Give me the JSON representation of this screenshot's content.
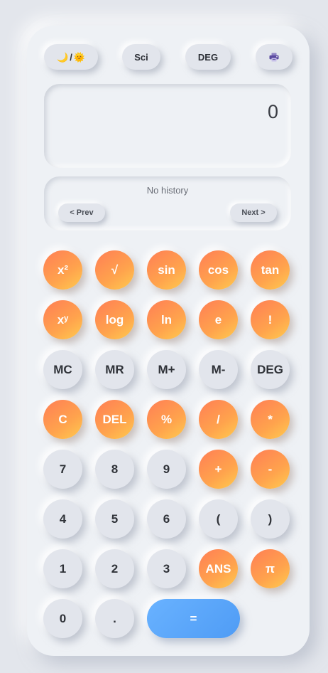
{
  "toolbar": {
    "theme_moon": "🌙",
    "theme_sep": "/",
    "theme_sun": "🌞",
    "mode_label": "Sci",
    "angle_label": "DEG",
    "print_icon": "printer-icon",
    "print_icon_color": "#5b4aa0"
  },
  "display": {
    "value": "0"
  },
  "history": {
    "text": "No history",
    "prev_label": "< Prev",
    "next_label": "Next >"
  },
  "keypad": {
    "rows": [
      [
        {
          "label": "x²",
          "name": "square"
        },
        {
          "label": "√",
          "name": "sqrt"
        },
        {
          "label": "sin",
          "name": "sin"
        },
        {
          "label": "cos",
          "name": "cos"
        },
        {
          "label": "tan",
          "name": "tan"
        }
      ],
      [
        {
          "label": "xʸ",
          "name": "power"
        },
        {
          "label": "log",
          "name": "log"
        },
        {
          "label": "ln",
          "name": "ln"
        },
        {
          "label": "e",
          "name": "euler"
        },
        {
          "label": "!",
          "name": "factorial"
        }
      ],
      [
        {
          "label": "MC",
          "name": "memory-clear"
        },
        {
          "label": "MR",
          "name": "memory-recall"
        },
        {
          "label": "M+",
          "name": "memory-add"
        },
        {
          "label": "M-",
          "name": "memory-subtract"
        },
        {
          "label": "DEG",
          "name": "deg"
        }
      ],
      [
        {
          "label": "C",
          "name": "clear"
        },
        {
          "label": "DEL",
          "name": "delete"
        },
        {
          "label": "%",
          "name": "percent"
        },
        {
          "label": "/",
          "name": "divide"
        },
        {
          "label": "*",
          "name": "multiply"
        }
      ],
      [
        {
          "label": "7",
          "name": "digit-7"
        },
        {
          "label": "8",
          "name": "digit-8"
        },
        {
          "label": "9",
          "name": "digit-9"
        },
        {
          "label": "+",
          "name": "add"
        },
        {
          "label": "-",
          "name": "subtract"
        }
      ],
      [
        {
          "label": "4",
          "name": "digit-4"
        },
        {
          "label": "5",
          "name": "digit-5"
        },
        {
          "label": "6",
          "name": "digit-6"
        },
        {
          "label": "(",
          "name": "open-paren"
        },
        {
          "label": ")",
          "name": "close-paren"
        }
      ],
      [
        {
          "label": "1",
          "name": "digit-1"
        },
        {
          "label": "2",
          "name": "digit-2"
        },
        {
          "label": "3",
          "name": "digit-3"
        },
        {
          "label": "ANS",
          "name": "answer"
        },
        {
          "label": "π",
          "name": "pi"
        }
      ],
      [
        {
          "label": "0",
          "name": "digit-0"
        },
        {
          "label": ".",
          "name": "decimal"
        },
        {
          "label": "=",
          "name": "equals"
        }
      ]
    ]
  },
  "colors": {
    "accent_orange_start": "#ff7e55",
    "accent_orange_end": "#ffcb4f",
    "accent_blue": "#5aa6fa",
    "surface": "#eef1f5",
    "key_gray": "#e2e5ec"
  }
}
